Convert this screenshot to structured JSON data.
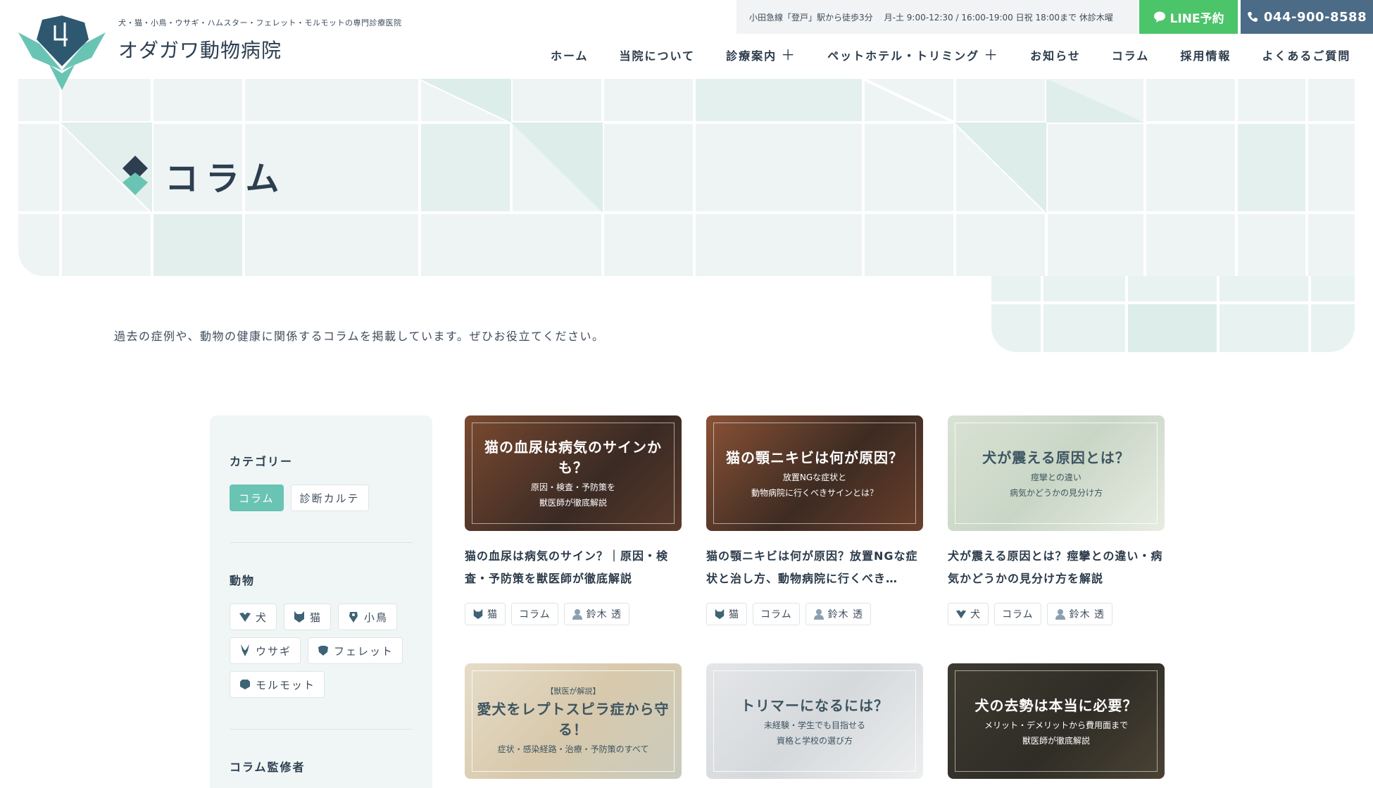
{
  "header": {
    "tagline": "犬・猫・小鳥・ウサギ・ハムスター・フェレット・モルモットの専門診療医院",
    "brand": "オダガワ動物病院",
    "access": "小田急線「登戸」駅から徒歩3分",
    "hours": "月-土 9:00-12:30 / 16:00-19:00 日祝 18:00まで 休診木曜",
    "line_label": "LINE予約",
    "tel_label": "044-900-8588"
  },
  "nav": [
    {
      "label": "ホーム"
    },
    {
      "label": "当院について"
    },
    {
      "label": "診療案内"
    },
    {
      "label": "ペットホテル・トリミング"
    },
    {
      "label": "お知らせ"
    },
    {
      "label": "コラム"
    },
    {
      "label": "採用情報"
    },
    {
      "label": "よくあるご質問"
    }
  ],
  "nav_expand_symbol": "＋",
  "hero": {
    "title": "コラム"
  },
  "intro": "過去の症例や、動物の健康に関係するコラムを掲載しています。ぜひお役立てください。",
  "sidebar": {
    "category_heading": "カテゴリー",
    "categories": [
      {
        "label": "コラム",
        "active": true
      },
      {
        "label": "診断カルテ",
        "active": false
      }
    ],
    "animal_heading": "動物",
    "animals": [
      {
        "label": "犬",
        "icon": "dog-icon"
      },
      {
        "label": "猫",
        "icon": "cat-icon"
      },
      {
        "label": "小鳥",
        "icon": "bird-icon"
      },
      {
        "label": "ウサギ",
        "icon": "rabbit-icon"
      },
      {
        "label": "フェレット",
        "icon": "ferret-icon"
      },
      {
        "label": "モルモット",
        "icon": "guinea-pig-icon"
      }
    ],
    "supervisor_heading": "コラム監修者"
  },
  "cards": [
    {
      "thumb_title": "猫の血尿は病気のサインかも？",
      "thumb_sub1": "原因・検査・予防策を",
      "thumb_sub2": "獣医師が徹底解説",
      "title": "猫の血尿は病気のサイン？｜原因・検査・予防策を獣医師が徹底解説",
      "animal": "猫",
      "category": "コラム",
      "author": "鈴木 透",
      "theme": "dark-orange"
    },
    {
      "thumb_title": "猫の顎ニキビは何が原因？",
      "thumb_sub1": "放置NGな症状と",
      "thumb_sub2": "動物病院に行くべきサインとは？",
      "title": "猫の顎ニキビは何が原因？放置NGな症状と治し方、動物病院に行くべき…",
      "animal": "猫",
      "category": "コラム",
      "author": "鈴木 透",
      "theme": "dark-orange"
    },
    {
      "thumb_title": "犬が震える原因とは？",
      "thumb_sub1": "痙攣との違い",
      "thumb_sub2": "病気かどうかの見分け方",
      "title": "犬が震える原因とは？痙攣との違い・病気かどうかの見分け方を解説",
      "animal": "犬",
      "category": "コラム",
      "author": "鈴木 透",
      "theme": "light-green"
    },
    {
      "thumb_pre": "【獣医が解説】",
      "thumb_title": "愛犬をレプトスピラ症から守る！",
      "thumb_sub1": "症状・感染経路・治療・予防策のすべて",
      "thumb_sub2": "",
      "theme": "light-beige"
    },
    {
      "thumb_title": "トリマーになるには？",
      "thumb_sub1": "未経験・学生でも目指せる",
      "thumb_sub2": "資格と学校の選び方",
      "theme": "light-gray"
    },
    {
      "thumb_title": "犬の去勢は本当に必要？",
      "thumb_sub1": "メリット・デメリットから費用面まで",
      "thumb_sub2": "獣医師が徹底解説",
      "theme": "dark-brown"
    }
  ],
  "colors": {
    "accent": "#6ac4b4",
    "navy": "#2c3e50",
    "line_green": "#4cc46a",
    "tel_blue": "#4b6b86",
    "hero_bg": "#eef4f3"
  }
}
